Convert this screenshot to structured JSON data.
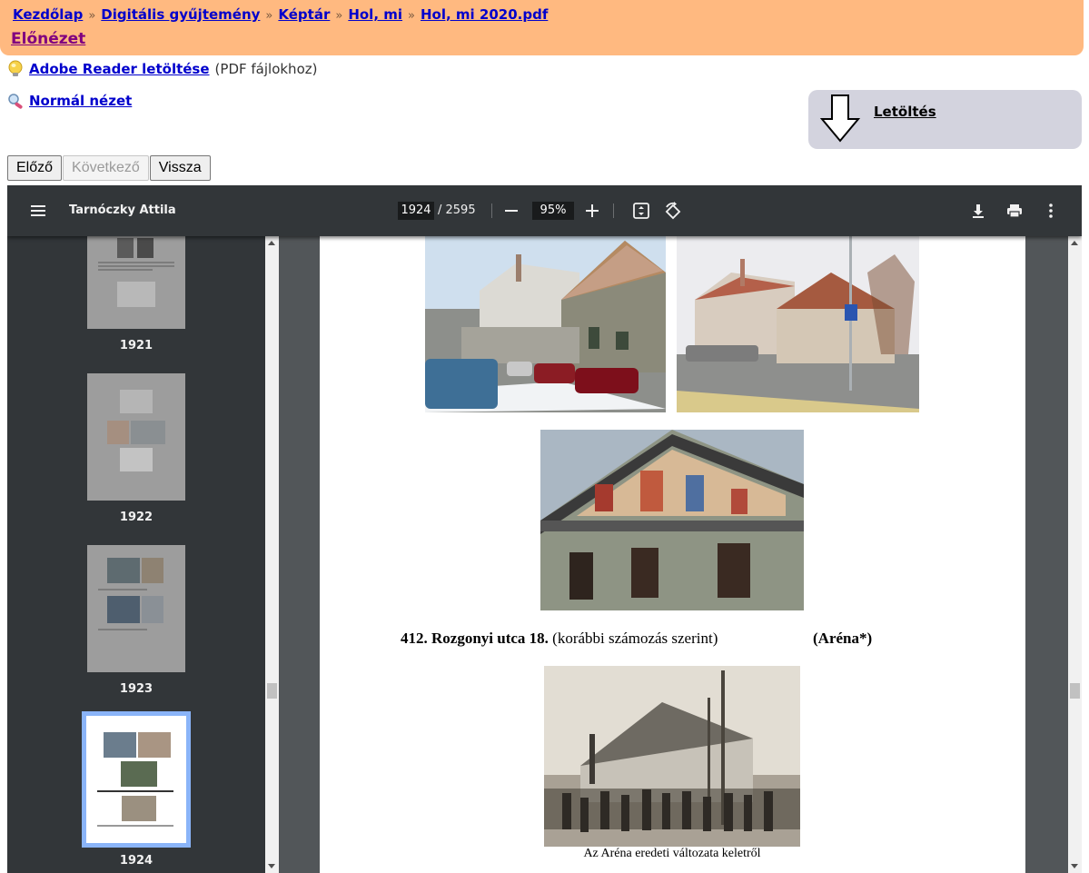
{
  "breadcrumb": {
    "items": [
      "Kezdőlap",
      "Digitális gyűjtemény",
      "Képtár",
      "Hol, mi",
      "Hol, mi 2020.pdf"
    ],
    "separator": "»"
  },
  "preview_label": "Előnézet",
  "adobe": {
    "link": "Adobe Reader letöltése",
    "note": "(PDF fájlokhoz)"
  },
  "normal_view": "Normál nézet",
  "download_label": "Letöltés",
  "nav": {
    "prev": "Előző",
    "next": "Következő",
    "back": "Vissza"
  },
  "viewer": {
    "doc_title": "Tarnóczky Attila",
    "current_page": "1924",
    "total_pages": "/ 2595",
    "zoom": "95%",
    "thumbnails": [
      {
        "label": "1921"
      },
      {
        "label": "1922"
      },
      {
        "label": "1923"
      },
      {
        "label": "1924",
        "active": true
      }
    ]
  },
  "page_content": {
    "heading_bold": "412. Rozgonyi utca 18.",
    "heading_normal": " (korábbi számozás szerint)",
    "tag": "(Aréna*)",
    "photo_caption": "Az Aréna eredeti változata keletről"
  },
  "colors": {
    "banner": "#ffb980",
    "download_box": "#d3d3de",
    "toolbar": "#323639",
    "viewer_bg": "#525659",
    "active_thumb_outline": "#8ab4f8"
  }
}
